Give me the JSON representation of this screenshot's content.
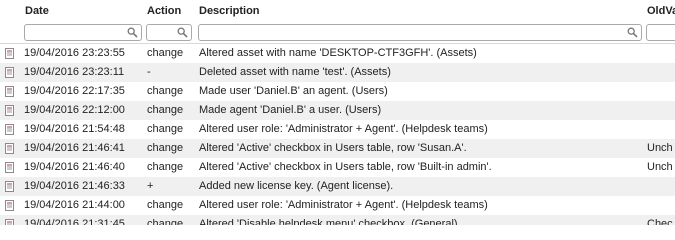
{
  "columns": {
    "date": "Date",
    "action": "Action",
    "description": "Description",
    "old_value": "OldVa"
  },
  "filters": {
    "date": "",
    "action": "",
    "description": "",
    "old_value": ""
  },
  "rows": [
    {
      "date": "19/04/2016 23:23:55",
      "action": "change",
      "description": "Altered asset with name 'DESKTOP-CTF3GFH'. (Assets)",
      "old_value": ""
    },
    {
      "date": "19/04/2016 23:23:11",
      "action": "-",
      "description": "Deleted asset with name 'test'. (Assets)",
      "old_value": ""
    },
    {
      "date": "19/04/2016 22:17:35",
      "action": "change",
      "description": "Made user 'Daniel.B' an agent. (Users)",
      "old_value": ""
    },
    {
      "date": "19/04/2016 22:12:00",
      "action": "change",
      "description": "Made agent 'Daniel.B' a user. (Users)",
      "old_value": ""
    },
    {
      "date": "19/04/2016 21:54:48",
      "action": "change",
      "description": "Altered user role: 'Administrator + Agent'. (Helpdesk teams)",
      "old_value": ""
    },
    {
      "date": "19/04/2016 21:46:41",
      "action": "change",
      "description": "Altered 'Active' checkbox in Users table, row 'Susan.A'.",
      "old_value": "Unch"
    },
    {
      "date": "19/04/2016 21:46:40",
      "action": "change",
      "description": "Altered 'Active' checkbox in Users table, row 'Built-in admin'.",
      "old_value": "Unch"
    },
    {
      "date": "19/04/2016 21:46:33",
      "action": "+",
      "description": "Added new license key. (Agent license).",
      "old_value": ""
    },
    {
      "date": "19/04/2016 21:44:00",
      "action": "change",
      "description": "Altered user role: 'Administrator + Agent'. (Helpdesk teams)",
      "old_value": ""
    },
    {
      "date": "19/04/2016 21:31:45",
      "action": "change",
      "description": "Altered 'Disable helpdesk menu' checkbox. (General)",
      "old_value": "Chec"
    }
  ],
  "icons": {
    "row_icon": "document-icon",
    "filter_icon": "search-icon"
  },
  "colors": {
    "alt_row": "#f0f0f0",
    "grid_line": "#d8d8d8"
  }
}
